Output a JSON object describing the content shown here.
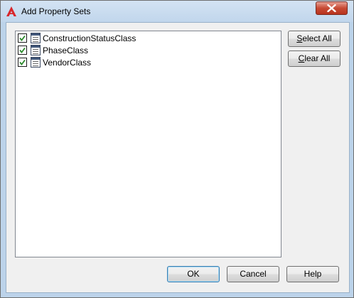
{
  "window": {
    "title": "Add Property Sets",
    "close_icon": "close-x-icon",
    "app_icon": "autocad-logo-icon"
  },
  "property_sets": [
    {
      "label": "ConstructionStatusClass",
      "checked": true
    },
    {
      "label": "PhaseClass",
      "checked": true
    },
    {
      "label": "VendorClass",
      "checked": true
    }
  ],
  "side_buttons": {
    "select_all": {
      "pre": "",
      "key": "S",
      "post": "elect All"
    },
    "clear_all": {
      "pre": "",
      "key": "C",
      "post": "lear All"
    }
  },
  "footer_buttons": {
    "ok": "OK",
    "cancel": "Cancel",
    "help": "Help"
  },
  "colors": {
    "title_bg": "#c1d6ec",
    "close_button": "#c74a34",
    "checkmark": "#2c8a2c",
    "dialog_bg": "#f0f0f0"
  }
}
